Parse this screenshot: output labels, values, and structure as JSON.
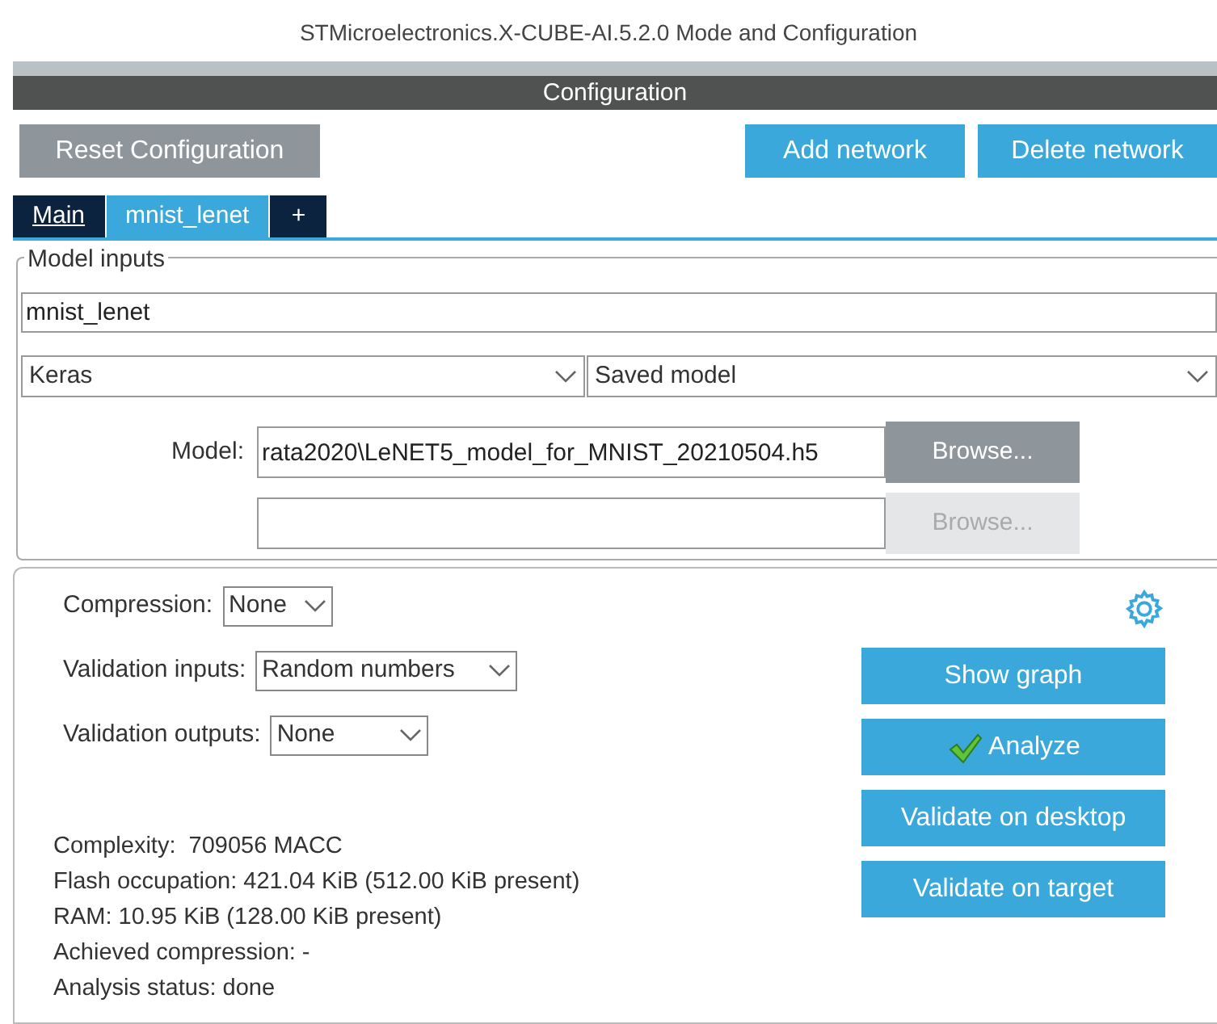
{
  "window": {
    "title": "STMicroelectronics.X-CUBE-AI.5.2.0 Mode and Configuration"
  },
  "header": {
    "title": "Configuration"
  },
  "toolbar": {
    "reset_button": "Reset Configuration",
    "buttons": [
      "Add network",
      "Delete network"
    ]
  },
  "tabs": [
    {
      "label": "Main",
      "selected": false,
      "kind": "link"
    },
    {
      "label": "mnist_lenet",
      "selected": true,
      "kind": "tab"
    },
    {
      "label": "+",
      "selected": false,
      "kind": "add"
    }
  ],
  "model_inputs": {
    "legend": "Model inputs",
    "name": "mnist_lenet",
    "framework": "Keras",
    "model_type": "Saved model",
    "model_label": "Model:",
    "files": [
      {
        "value": "rata2020\\LeNET5_model_for_MNIST_20210504.h5",
        "browse": "Browse...",
        "disabled": false
      },
      {
        "browse": "Browse...",
        "disabled": true
      }
    ]
  },
  "settings": [
    {
      "label": "Compression:",
      "value": "None"
    },
    {
      "label": "Validation inputs:",
      "value": "Random numbers"
    },
    {
      "label": "Validation outputs:",
      "value": "None"
    }
  ],
  "actions": [
    {
      "label": "Show graph",
      "done": false
    },
    {
      "label": "Analyze",
      "done": true
    },
    {
      "label": "Validate on desktop",
      "done": false
    },
    {
      "label": "Validate on target",
      "done": false
    }
  ],
  "stats": [
    "Complexity:  709056 MACC",
    "Flash occupation: 421.04 KiB (512.00 KiB present)",
    "RAM: 10.95 KiB (128.00 KiB present)",
    "Achieved compression: -",
    "Analysis status: done"
  ]
}
